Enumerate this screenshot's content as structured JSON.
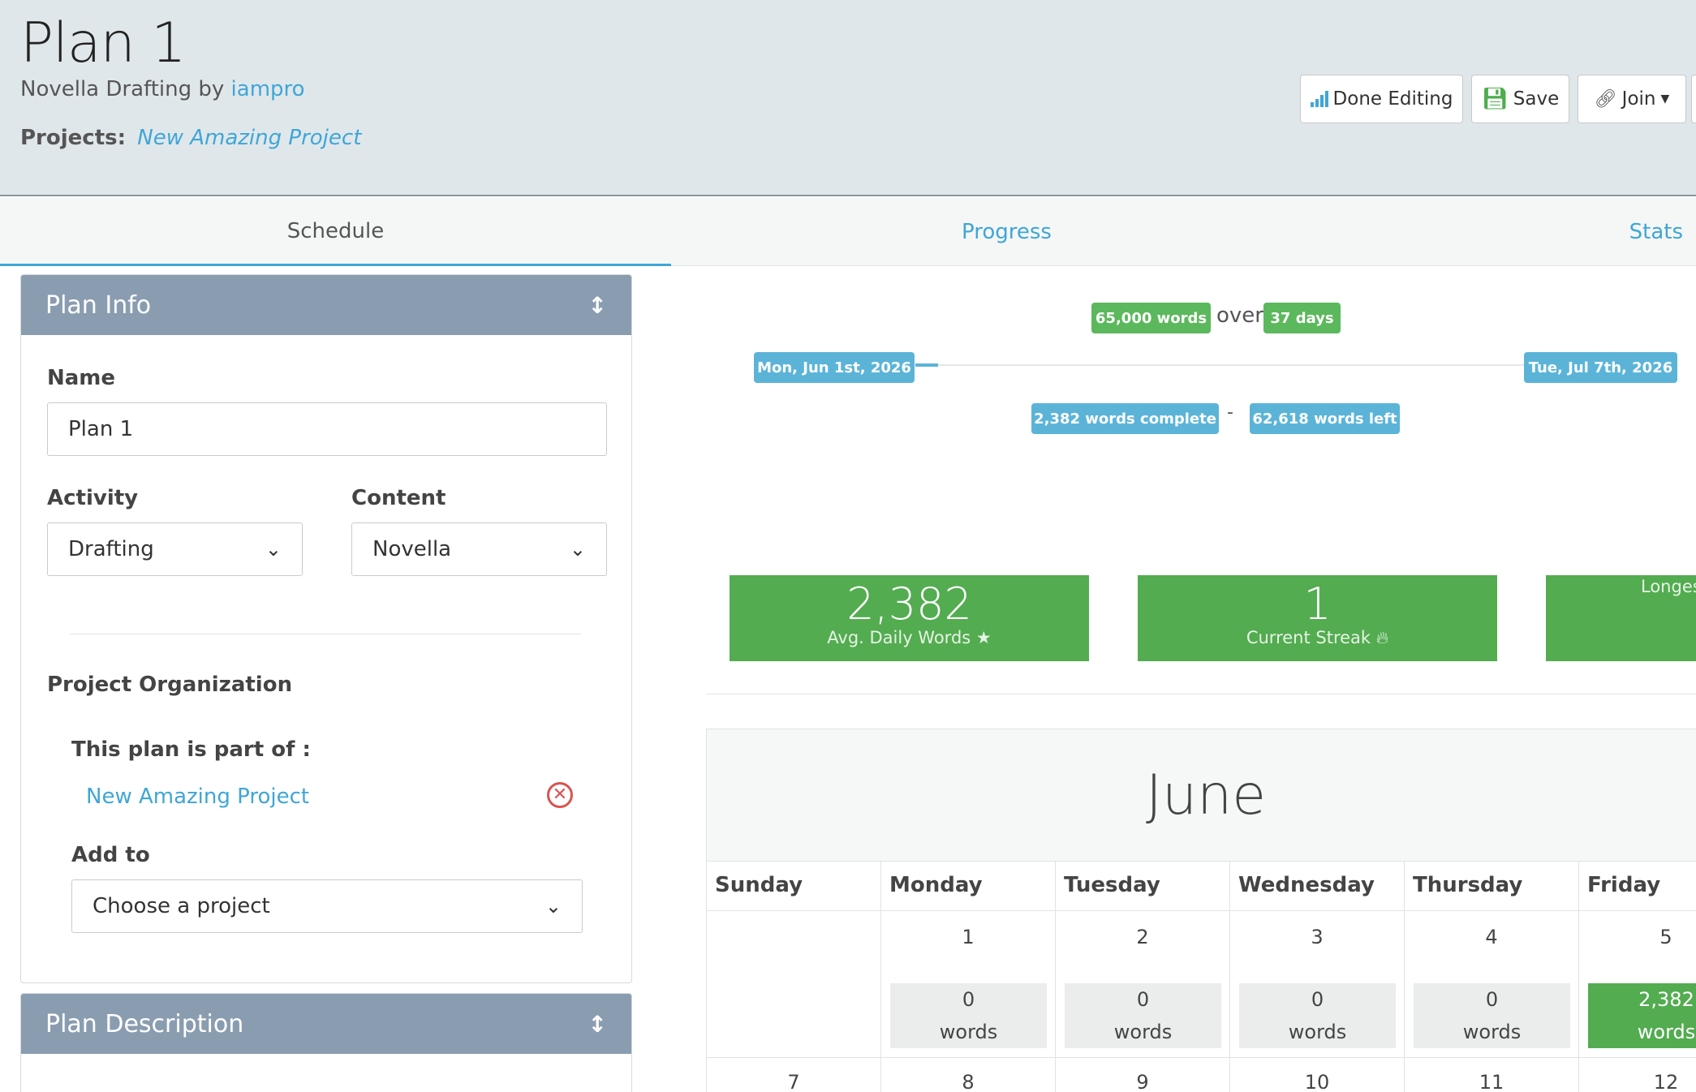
{
  "header": {
    "title": "Plan 1",
    "subtitle_prefix": "Novella Drafting by",
    "author": "iampro",
    "projects_label": "Projects:",
    "project_link": "New Amazing Project",
    "buttons": {
      "done_editing": "Done Editing",
      "save": "Save",
      "join": "Join"
    }
  },
  "tabs": [
    {
      "label": "Schedule",
      "active": true
    },
    {
      "label": "Progress",
      "active": false
    },
    {
      "label": "Stats",
      "active": false
    }
  ],
  "plan_info": {
    "heading": "Plan Info",
    "name_label": "Name",
    "name_value": "Plan 1",
    "activity_label": "Activity",
    "activity_value": "Drafting",
    "content_label": "Content",
    "content_value": "Novella",
    "org_label": "Project Organization",
    "part_of_label": "This plan is part of :",
    "part_of_project": "New Amazing Project",
    "add_to_label": "Add to",
    "add_to_placeholder": "Choose a project"
  },
  "plan_description": {
    "heading": "Plan Description"
  },
  "summary": {
    "goal_words": "65,000 words",
    "over": "over",
    "goal_days": "37 days",
    "start_date": "Mon, Jun 1st, 2026",
    "end_date": "Tue, Jul 7th, 2026",
    "progress_fraction": 0.037,
    "complete": "2,382 words complete",
    "separator": "-",
    "left": "62,618 words left"
  },
  "stats": [
    {
      "value": "2,382",
      "caption": "Avg. Daily Words",
      "icon": "star-icon"
    },
    {
      "value": "1",
      "caption": "Current Streak",
      "icon": "flame-icon"
    },
    {
      "value": "",
      "caption": "Longes",
      "icon": ""
    }
  ],
  "calendar": {
    "month": "June",
    "days": [
      "Sunday",
      "Monday",
      "Tuesday",
      "Wednesday",
      "Thursday",
      "Friday"
    ],
    "week1": [
      {
        "day": "",
        "count": "",
        "unit": ""
      },
      {
        "day": "1",
        "count": "0",
        "unit": "words"
      },
      {
        "day": "2",
        "count": "0",
        "unit": "words"
      },
      {
        "day": "3",
        "count": "0",
        "unit": "words"
      },
      {
        "day": "4",
        "count": "0",
        "unit": "words"
      },
      {
        "day": "5",
        "count": "2,382",
        "unit": "words"
      }
    ],
    "week2": [
      "7",
      "8",
      "9",
      "10",
      "11",
      "12"
    ]
  },
  "colors": {
    "accent_blue": "#3fa6d6",
    "success_green": "#53ac50",
    "panel_header": "#8a9db0",
    "header_bg": "#e0e7eb"
  }
}
